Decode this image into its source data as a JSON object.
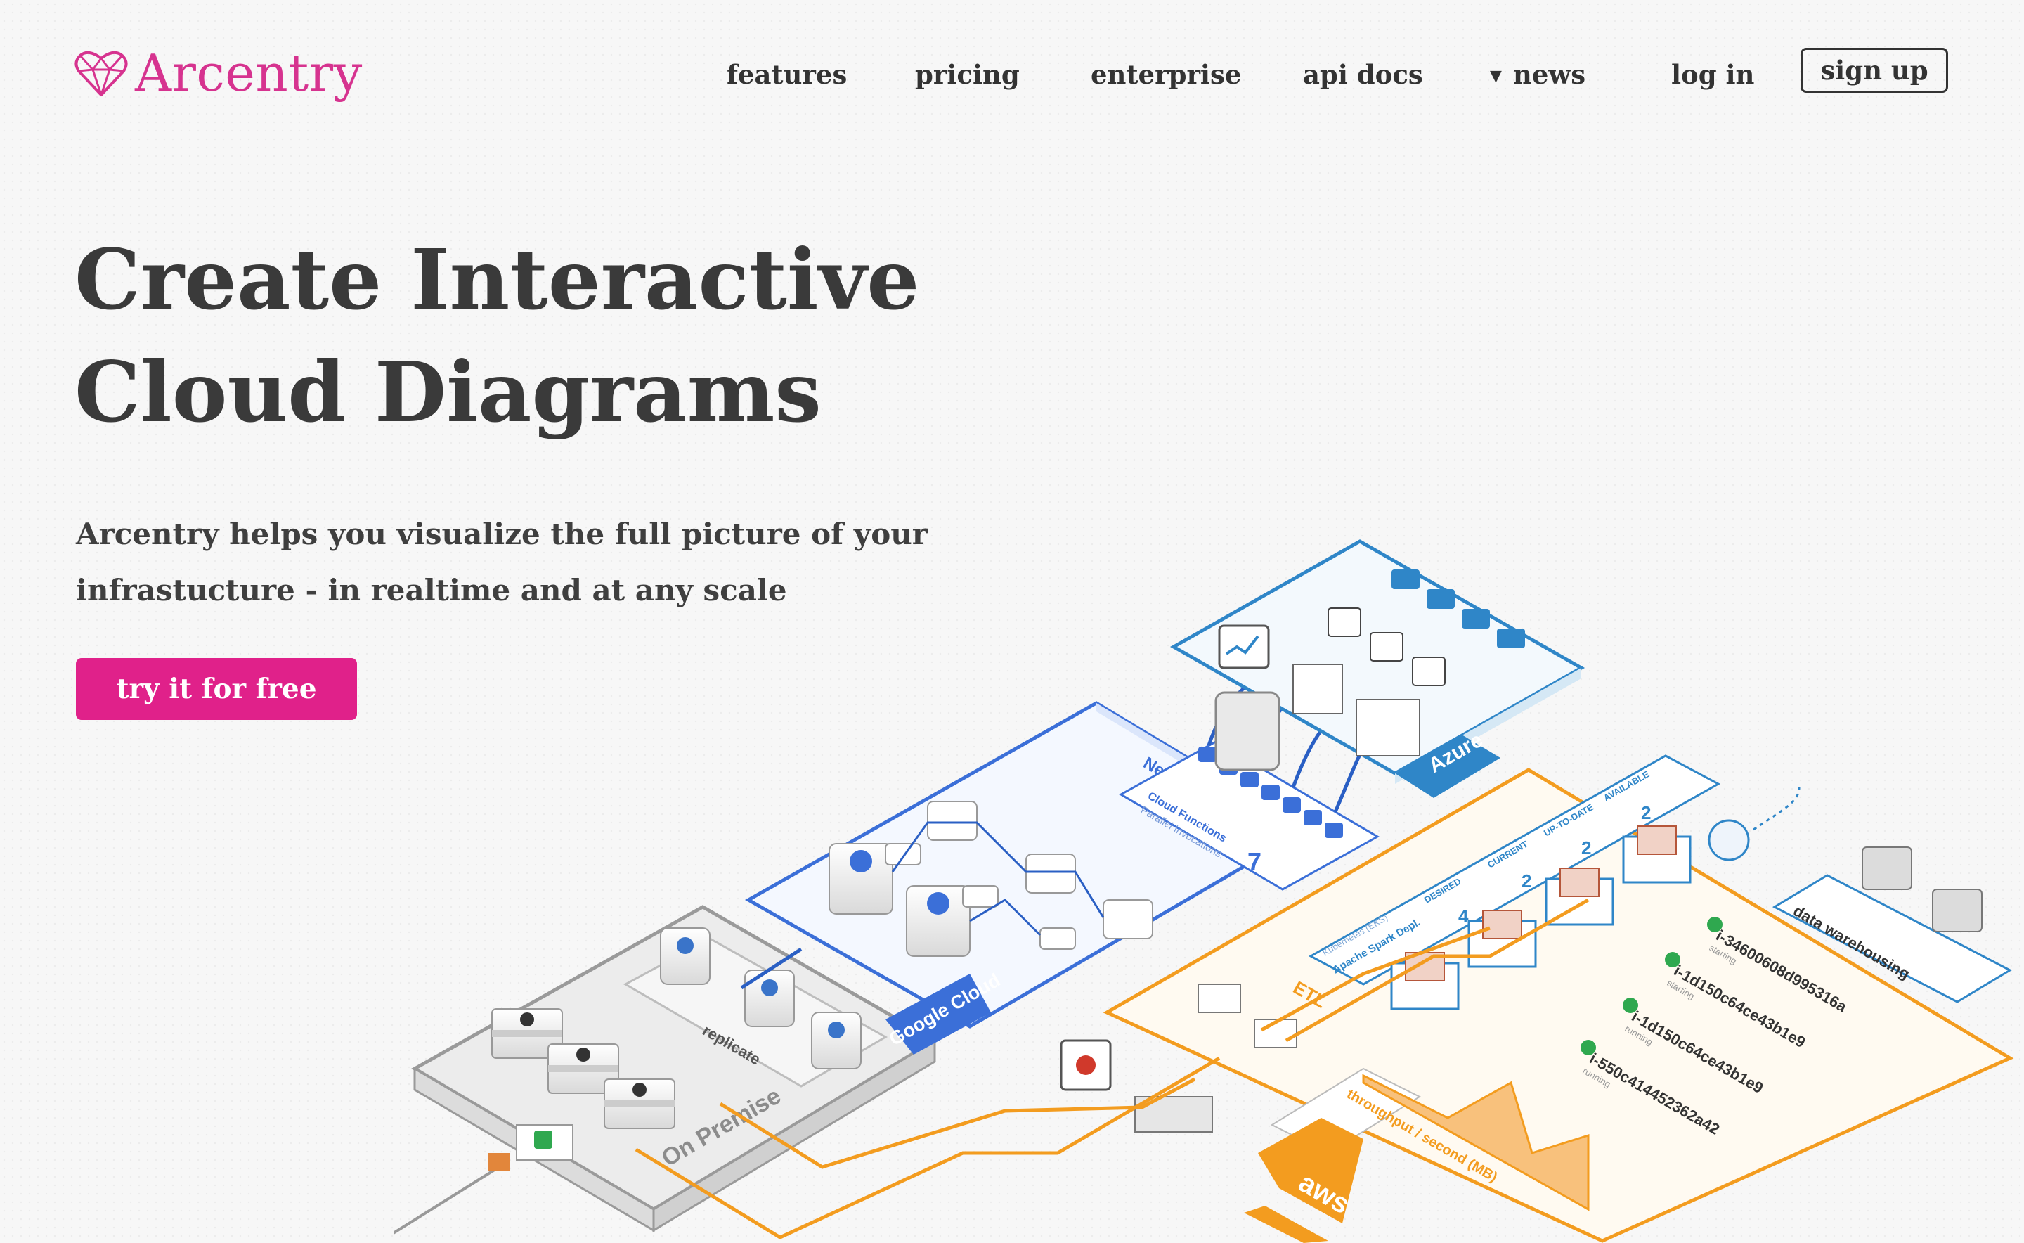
{
  "brand": {
    "name": "Arcentry",
    "color": "#d6338f",
    "logo_icon": "heart-facet-icon"
  },
  "nav": {
    "features": "features",
    "pricing": "pricing",
    "enterprise": "enterprise",
    "api_docs": "api docs",
    "news": "news",
    "news_icon": "caret-down-icon",
    "login": "log in",
    "signup": "sign up"
  },
  "hero": {
    "title_line1": "Create Interactive",
    "title_line2": "Cloud Diagrams",
    "subtitle_line1": "Arcentry helps you visualize the full picture of your",
    "subtitle_line2": "infrastucture - in realtime and at any scale",
    "cta": "try it for free",
    "cta_color": "#e0218a"
  },
  "diagram": {
    "colors": {
      "azure": "#2f86c8",
      "google": "#3b6fd8",
      "aws": "#f39c1f",
      "onprem": "#9a9a9a"
    },
    "azure_label": "Azure",
    "google_label": "Google Cloud",
    "aws_label": "aws",
    "onprem_label": "On Premise",
    "replicate_label": "replicate",
    "etl_label": "ETL",
    "neural_label": "Neural Network Output",
    "cloud_functions": {
      "title": "Cloud Functions",
      "subtitle": "Parallel Invocations:",
      "value": "7"
    },
    "kubernetes": {
      "name": "Kubernetes (EKS)",
      "deployment": "Apache Spark Depl.",
      "headers": [
        "DESIRED",
        "CURRENT",
        "UP-TO-DATE",
        "AVAILABLE"
      ],
      "values": [
        "4",
        "2",
        "2",
        "2"
      ]
    },
    "data_warehousing_label": "data warehousing",
    "instances": [
      {
        "id": "i-34600608d995316a",
        "status": "starting"
      },
      {
        "id": "i-1d150c64ce43b1e9",
        "status": "starting"
      },
      {
        "id": "i-1d150c64ce43b1e9",
        "status": "running"
      },
      {
        "id": "i-550c414452362a42",
        "status": "running"
      }
    ],
    "throughput_label": "throughput / second (MB)"
  }
}
